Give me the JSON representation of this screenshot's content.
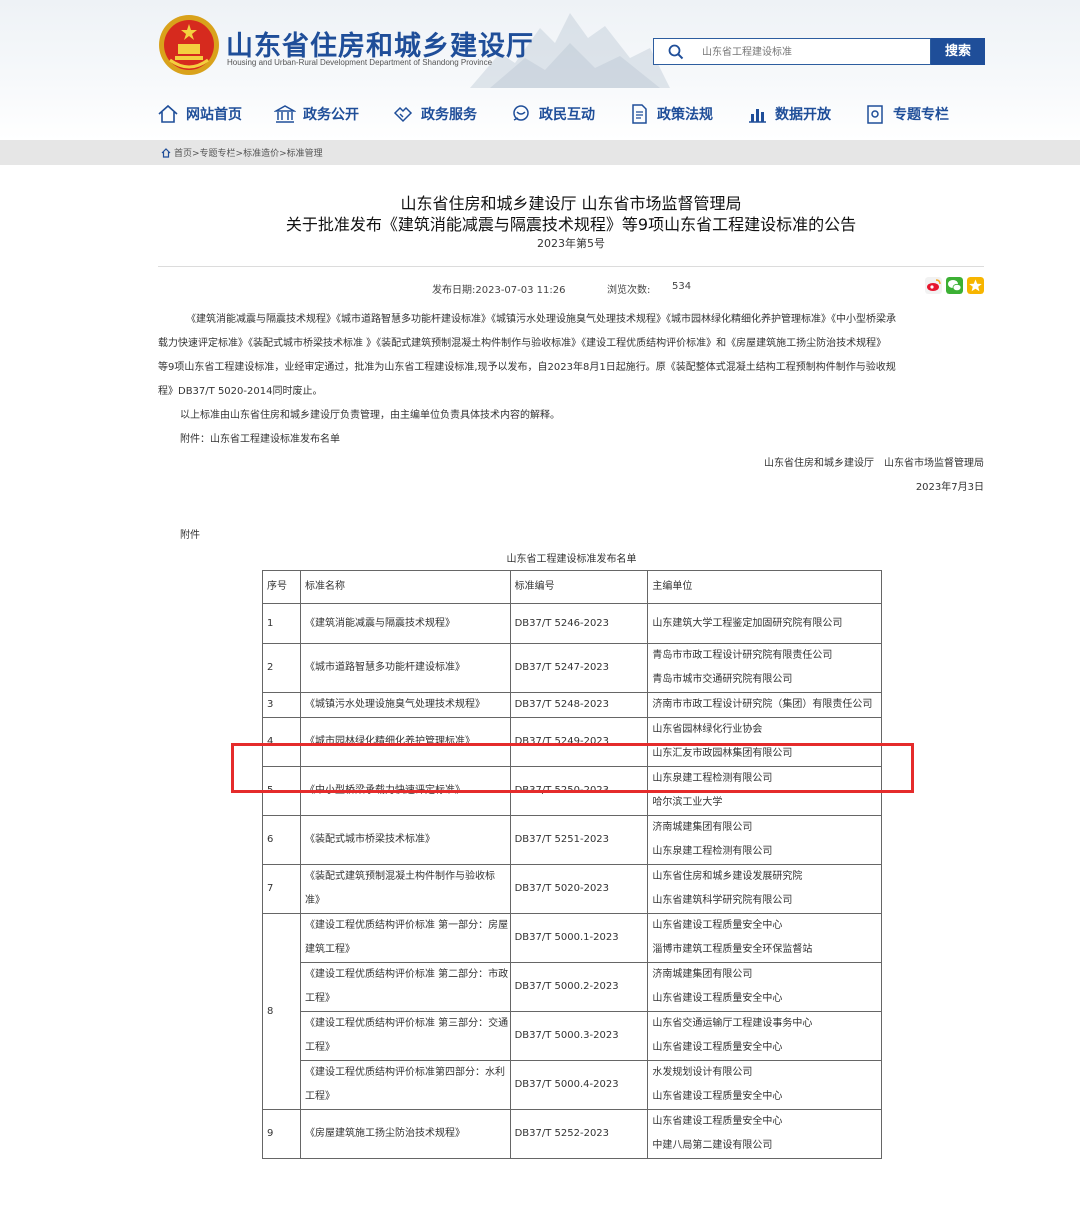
{
  "header": {
    "title": "山东省住房和城乡建设厅",
    "subtitle": "Housing and Urban-Rural Development Department of Shandong Province",
    "search_placeholder": "山东省工程建设标准",
    "search_button": "搜索"
  },
  "nav": [
    {
      "label": "网站首页",
      "icon": "home-icon"
    },
    {
      "label": "政务公开",
      "icon": "government-building-icon"
    },
    {
      "label": "政务服务",
      "icon": "handshake-icon"
    },
    {
      "label": "政民互动",
      "icon": "interaction-icon"
    },
    {
      "label": "政策法规",
      "icon": "document-icon"
    },
    {
      "label": "数据开放",
      "icon": "bar-chart-icon"
    },
    {
      "label": "专题专栏",
      "icon": "topic-icon"
    }
  ],
  "breadcrumb": "首页>专题专栏>标准造价>标准管理",
  "article": {
    "title_line1": "山东省住房和城乡建设厅 山东省市场监督管理局",
    "title_line2": "关于批准发布《建筑消能减震与隔震技术规程》等9项山东省工程建设标准的公告",
    "doc_number": "2023年第5号",
    "publish_date": "发布日期:2023-07-03 11:26",
    "views_label": "浏览次数:",
    "views": "534",
    "para1_lines": [
      "《建筑消能减震与隔震技术规程》《城市道路智慧多功能杆建设标准》《城镇污水处理设施臭气处理技术规程》《城市园林绿化精细化养护管理标准》《中小型桥梁承",
      "载力快速评定标准》《装配式城市桥梁技术标准 》《装配式建筑预制混凝土构件制作与验收标准》《建设工程优质结构评价标准》和《房屋建筑施工扬尘防治技术规程》",
      "等9项山东省工程建设标准，业经审定通过，批准为山东省工程建设标准,现予以发布，自2023年8月1日起施行。原《装配整体式混凝土结构工程预制构件制作与验收规",
      "程》DB37/T 5020-2014同时废止。"
    ],
    "para2": "以上标准由山东省住房和城乡建设厅负责管理，由主编单位负责具体技术内容的解释。",
    "attachment_line": "附件：山东省工程建设标准发布名单",
    "signatories": "山东省住房和城乡建设厅　山东省市场监督管理局",
    "sign_date": "2023年7月3日",
    "attachment_label": "附件",
    "table_caption": "山东省工程建设标准发布名单"
  },
  "table": {
    "headers": [
      "序号",
      "标准名称",
      "标准编号",
      "主编单位"
    ],
    "rows": [
      {
        "no": "1",
        "name": "《建筑消能减震与隔震技术规程》",
        "code": "DB37/T 5246-2023",
        "units": [
          "山东建筑大学工程鉴定加固研究院有限公司"
        ]
      },
      {
        "no": "2",
        "name": "《城市道路智慧多功能杆建设标准》",
        "code": "DB37/T 5247-2023",
        "units": [
          "青岛市市政工程设计研究院有限责任公司",
          "青岛市城市交通研究院有限公司"
        ]
      },
      {
        "no": "3",
        "name": "《城镇污水处理设施臭气处理技术规程》",
        "code": "DB37/T 5248-2023",
        "units": [
          "济南市市政工程设计研究院（集团）有限责任公司"
        ]
      },
      {
        "no": "4",
        "name": "《城市园林绿化精细化养护管理标准》",
        "code": "DB37/T 5249-2023",
        "units": [
          "山东省园林绿化行业协会",
          "山东汇友市政园林集团有限公司"
        ]
      },
      {
        "no": "5",
        "name": "《中小型桥梁承载力快速评定标准》",
        "code": "DB37/T 5250-2023",
        "units": [
          "山东泉建工程检测有限公司",
          "哈尔滨工业大学"
        ]
      },
      {
        "no": "6",
        "name": "《装配式城市桥梁技术标准》",
        "code": "DB37/T 5251-2023",
        "units": [
          "济南城建集团有限公司",
          "山东泉建工程检测有限公司"
        ]
      },
      {
        "no": "7",
        "name": "《装配式建筑预制混凝土构件制作与验收标准》",
        "code": "DB37/T 5020-2023",
        "units": [
          "山东省住房和城乡建设发展研究院",
          "山东省建筑科学研究院有限公司"
        ]
      },
      {
        "no": "8",
        "name": "《建设工程优质结构评价标准 第一部分：房屋建筑工程》",
        "code": "DB37/T 5000.1-2023",
        "units": [
          "山东省建设工程质量安全中心",
          "淄博市建筑工程质量安全环保监督站"
        ]
      },
      {
        "no": "",
        "name": "《建设工程优质结构评价标准 第二部分：市政工程》",
        "code": "DB37/T 5000.2-2023",
        "units": [
          "济南城建集团有限公司",
          "山东省建设工程质量安全中心"
        ]
      },
      {
        "no": "",
        "name": "《建设工程优质结构评价标准 第三部分：交通工程》",
        "code": "DB37/T 5000.3-2023",
        "units": [
          "山东省交通运输厅工程建设事务中心",
          "山东省建设工程质量安全中心"
        ]
      },
      {
        "no": "",
        "name": "《建设工程优质结构评价标准第四部分：水利工程》",
        "code": "DB37/T 5000.4-2023",
        "units": [
          "水发规划设计有限公司",
          "山东省建设工程质量安全中心"
        ]
      },
      {
        "no": "9",
        "name": "《房屋建筑施工扬尘防治技术规程》",
        "code": "DB37/T 5252-2023",
        "units": [
          "山东省建设工程质量安全中心",
          "中建八局第二建设有限公司"
        ]
      }
    ]
  },
  "colors": {
    "brand_blue": "#1f4e99",
    "highlight_red": "#e52b2b",
    "crumb_bg": "#e6e6e6"
  }
}
